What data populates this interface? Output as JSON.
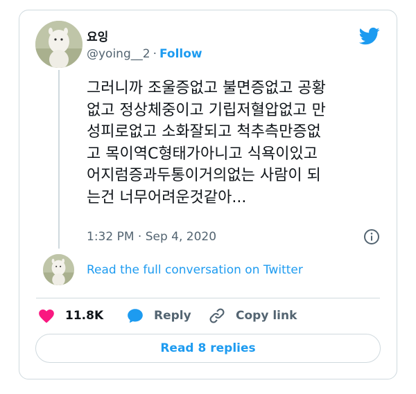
{
  "tweet": {
    "display_name": "요잉",
    "handle": "@yoing__2",
    "separator": "·",
    "follow_label": "Follow",
    "text_lines": [
      "그러니까 조울증없고 불면증없고 공황",
      "없고 정상체중이고 기립저혈압없고 만",
      "성피로없고 소화잘되고 척추측만증없",
      "고 목이역C형태가아니고 식욕이있고",
      "어지럼증과두통이거의없는 사람이 되",
      "는건 너무어려운것같아..."
    ],
    "timestamp": "1:32 PM · Sep 4, 2020"
  },
  "conversation": {
    "link_label": "Read the full conversation on Twitter"
  },
  "actions": {
    "likes_count": "11.8K",
    "reply_label": "Reply",
    "copy_link_label": "Copy link"
  },
  "footer": {
    "read_replies_label": "Read 8 replies"
  },
  "icons": {
    "brand": "twitter-bird-icon",
    "like": "heart-icon",
    "reply": "speech-bubble-icon",
    "copy": "link-icon",
    "info": "info-icon"
  },
  "colors": {
    "accent": "#1d9bf0",
    "like": "#f91880",
    "muted": "#536471",
    "text": "#0f1419",
    "border": "#cfd9de"
  }
}
